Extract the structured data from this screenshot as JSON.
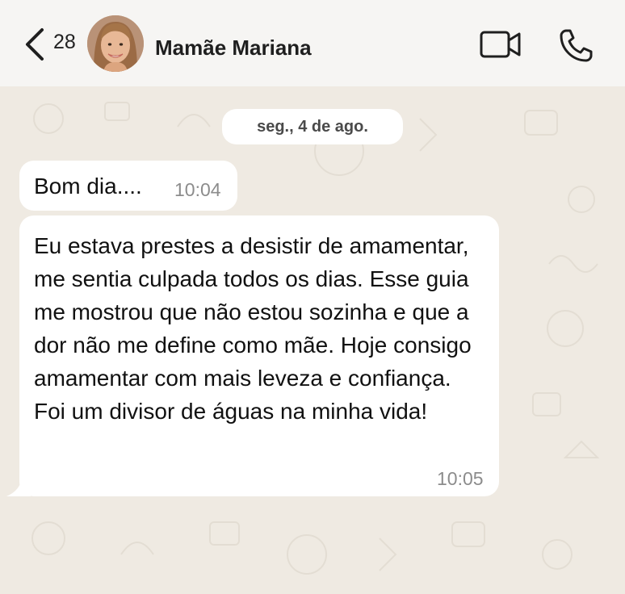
{
  "header": {
    "unread_count": "28",
    "contact_name": "Mamãe Mariana",
    "icons": [
      "chevron-left-icon",
      "video-camera-icon",
      "phone-icon"
    ]
  },
  "chat": {
    "date_chip": "seg., 4 de ago.",
    "messages": [
      {
        "text": "Bom dia....",
        "time": "10:04"
      },
      {
        "text": "Eu estava prestes a desistir de amamentar, me sentia culpada todos os dias. Esse guia me mostrou que não estou sozinha e que a dor não me define como mãe. Hoje consigo amamentar com mais leveza e confiança. Foi um divisor de águas na minha vida!",
        "time": "10:05"
      }
    ]
  },
  "colors": {
    "header_bg": "#f6f5f3",
    "chat_bg": "#efeae2",
    "bubble_bg": "#ffffff",
    "timestamp": "#8c8c8c"
  }
}
